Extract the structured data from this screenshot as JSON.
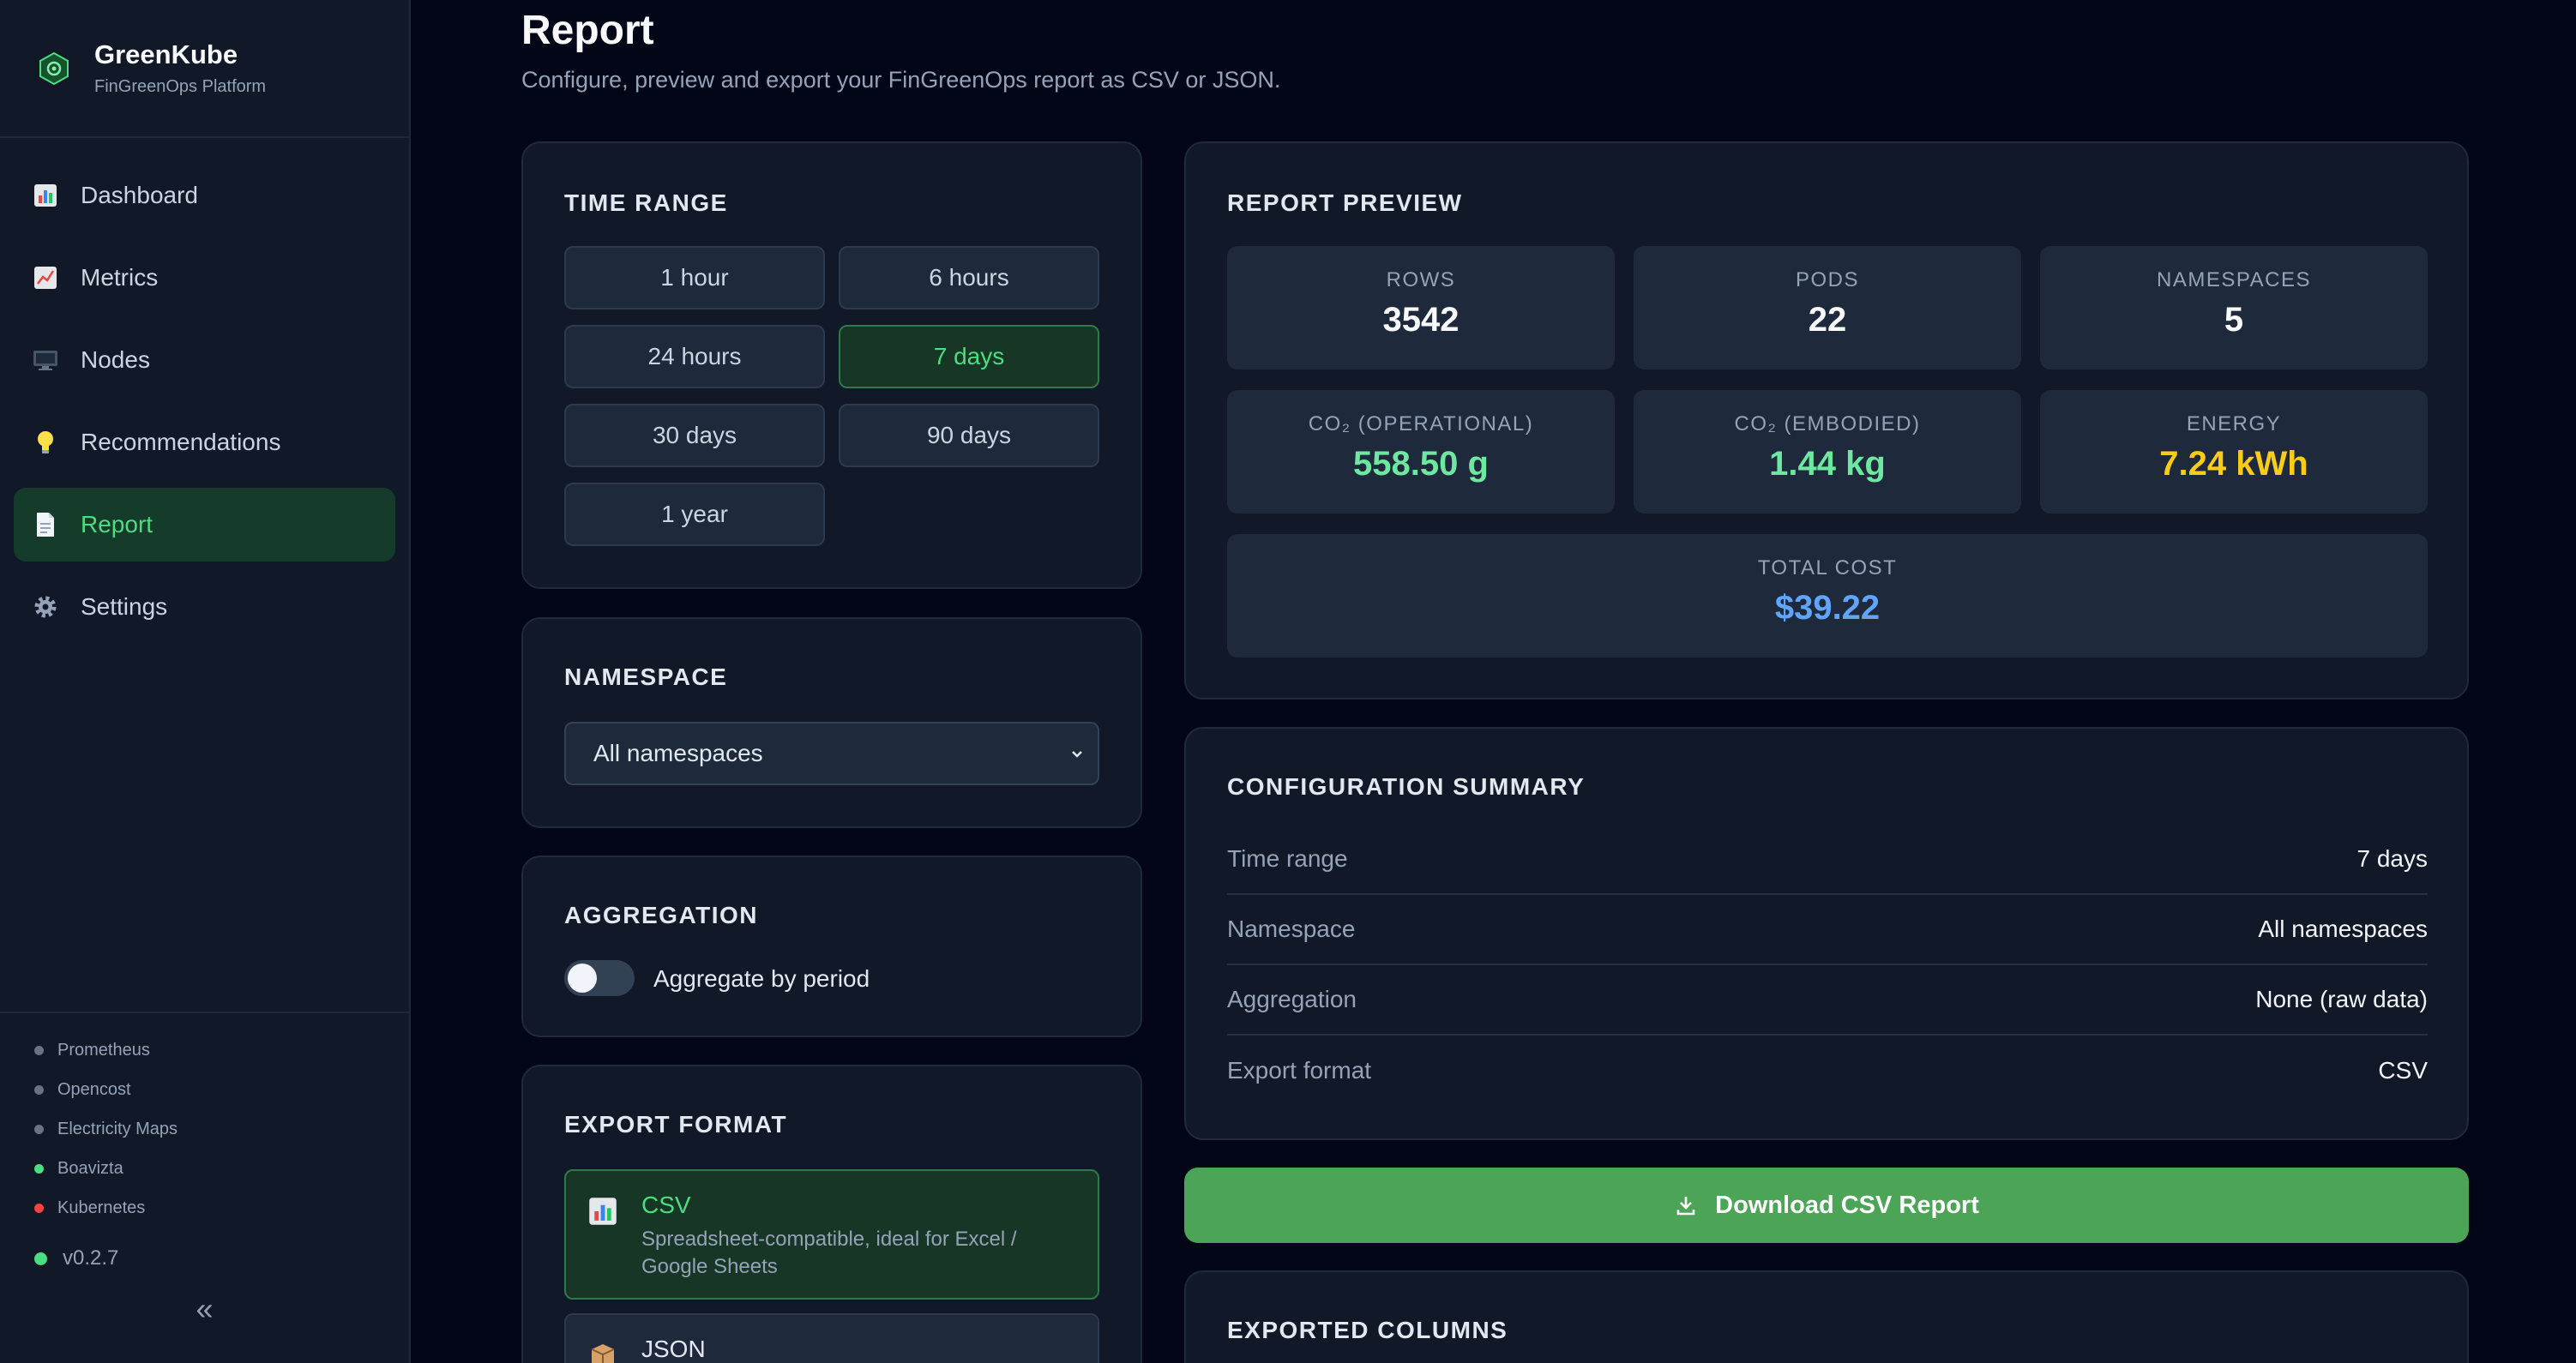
{
  "sidebar": {
    "brand": {
      "title": "GreenKube",
      "subtitle": "FinGreenOps Platform"
    },
    "nav": [
      {
        "label": "Dashboard",
        "icon": "bar-chart-icon"
      },
      {
        "label": "Metrics",
        "icon": "trend-chart-icon"
      },
      {
        "label": "Nodes",
        "icon": "monitor-icon"
      },
      {
        "label": "Recommendations",
        "icon": "lightbulb-icon"
      },
      {
        "label": "Report",
        "icon": "document-icon",
        "active": true
      },
      {
        "label": "Settings",
        "icon": "gear-icon"
      }
    ],
    "services": [
      {
        "name": "Prometheus",
        "status": "unknown"
      },
      {
        "name": "Opencost",
        "status": "unknown"
      },
      {
        "name": "Electricity Maps",
        "status": "unknown"
      },
      {
        "name": "Boavizta",
        "status": "ok"
      },
      {
        "name": "Kubernetes",
        "status": "error"
      }
    ],
    "version": "v0.2.7",
    "collapse_label": "«"
  },
  "page": {
    "title": "Report",
    "subtitle": "Configure, preview and export your FinGreenOps report as CSV or JSON."
  },
  "time_range": {
    "heading": "TIME RANGE",
    "options": [
      "1 hour",
      "6 hours",
      "24 hours",
      "7 days",
      "30 days",
      "90 days",
      "1 year"
    ],
    "selected": "7 days"
  },
  "namespace": {
    "heading": "NAMESPACE",
    "selected": "All namespaces"
  },
  "aggregation": {
    "heading": "AGGREGATION",
    "toggle_label": "Aggregate by period",
    "enabled": false
  },
  "export_format": {
    "heading": "EXPORT FORMAT",
    "options": [
      {
        "name": "CSV",
        "description": "Spreadsheet-compatible, ideal for Excel / Google Sheets",
        "icon": "bar-chart-icon",
        "selected": true
      },
      {
        "name": "JSON",
        "description": "",
        "icon": "package-icon",
        "selected": false
      }
    ]
  },
  "preview": {
    "heading": "REPORT PREVIEW",
    "stats": [
      {
        "label": "ROWS",
        "value": "3542"
      },
      {
        "label": "PODS",
        "value": "22"
      },
      {
        "label": "NAMESPACES",
        "value": "5"
      },
      {
        "label": "CO₂ (OPERATIONAL)",
        "value": "558.50 g"
      },
      {
        "label": "CO₂ (EMBODIED)",
        "value": "1.44 kg"
      },
      {
        "label": "ENERGY",
        "value": "7.24 kWh"
      },
      {
        "label": "TOTAL COST",
        "value": "$39.22"
      }
    ],
    "colors": {
      "co2": "#6ee7a0",
      "energy": "#facc15",
      "cost": "#60a5fa"
    }
  },
  "config_summary": {
    "heading": "CONFIGURATION SUMMARY",
    "rows": [
      {
        "key": "Time range",
        "value": "7 days"
      },
      {
        "key": "Namespace",
        "value": "All namespaces"
      },
      {
        "key": "Aggregation",
        "value": "None (raw data)"
      },
      {
        "key": "Export format",
        "value": "CSV"
      }
    ]
  },
  "download": {
    "label": "Download CSV Report",
    "icon": "download-icon",
    "color": "#4ca557"
  },
  "exported_columns": {
    "heading": "EXPORTED COLUMNS"
  }
}
